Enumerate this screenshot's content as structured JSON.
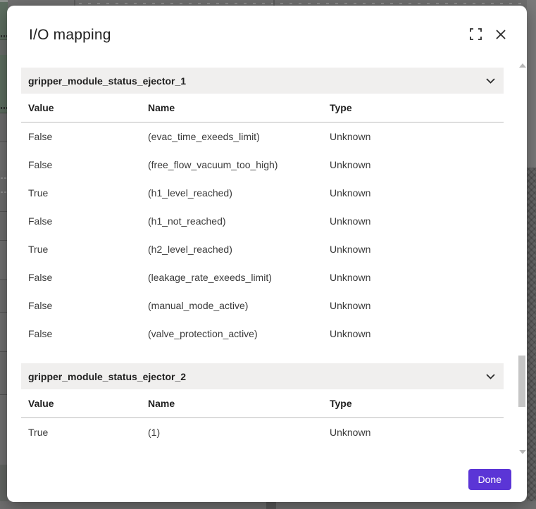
{
  "modal": {
    "title": "I/O mapping",
    "done_label": "Done"
  },
  "sections": [
    {
      "name": "gripper_module_status_ejector_1",
      "columns": [
        "Value",
        "Name",
        "Type"
      ],
      "rows": [
        [
          "False",
          "(evac_time_exeeds_limit)",
          "Unknown"
        ],
        [
          "False",
          "(free_flow_vacuum_too_high)",
          "Unknown"
        ],
        [
          "True",
          "(h1_level_reached)",
          "Unknown"
        ],
        [
          "False",
          "(h1_not_reached)",
          "Unknown"
        ],
        [
          "True",
          "(h2_level_reached)",
          "Unknown"
        ],
        [
          "False",
          "(leakage_rate_exeeds_limit)",
          "Unknown"
        ],
        [
          "False",
          "(manual_mode_active)",
          "Unknown"
        ],
        [
          "False",
          "(valve_protection_active)",
          "Unknown"
        ]
      ]
    },
    {
      "name": "gripper_module_status_ejector_2",
      "columns": [
        "Value",
        "Name",
        "Type"
      ],
      "rows": [
        [
          "True",
          "(1)",
          "Unknown"
        ]
      ]
    }
  ],
  "icons": {
    "header": [
      "fullscreen-icon",
      "close-icon"
    ],
    "section": "chevron-down-icon"
  },
  "colors": {
    "accent": "#5b35d6",
    "section_header_bg": "#f0efee",
    "overlay": "#6f6f6f"
  }
}
